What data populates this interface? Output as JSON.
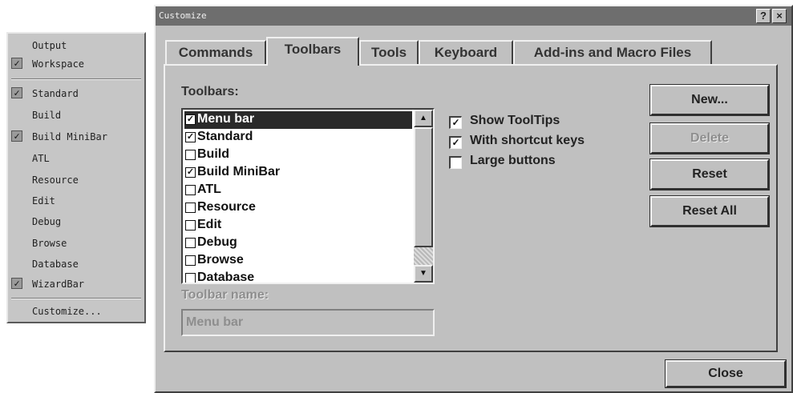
{
  "context_menu": {
    "items": [
      {
        "label": "Output",
        "checked": false
      },
      {
        "label": "Workspace",
        "checked": true
      },
      {
        "label": "Standard",
        "checked": true
      },
      {
        "label": "Build",
        "checked": false
      },
      {
        "label": "Build MiniBar",
        "checked": true
      },
      {
        "label": "ATL",
        "checked": false
      },
      {
        "label": "Resource",
        "checked": false
      },
      {
        "label": "Edit",
        "checked": false
      },
      {
        "label": "Debug",
        "checked": false
      },
      {
        "label": "Browse",
        "checked": false
      },
      {
        "label": "Database",
        "checked": false
      },
      {
        "label": "WizardBar",
        "checked": true
      },
      {
        "label": "Customize...",
        "checked": false
      }
    ]
  },
  "dialog": {
    "title": "Customize",
    "help_glyph": "?",
    "close_glyph": "×",
    "tabs": [
      {
        "label": "Commands",
        "active": false
      },
      {
        "label": "Toolbars",
        "active": true
      },
      {
        "label": "Tools",
        "active": false
      },
      {
        "label": "Keyboard",
        "active": false
      },
      {
        "label": "Add-ins and Macro Files",
        "active": false
      }
    ],
    "toolbars_label": "Toolbars:",
    "toolbar_list": [
      {
        "label": "Menu bar",
        "checked": true,
        "selected": true
      },
      {
        "label": "Standard",
        "checked": true,
        "selected": false
      },
      {
        "label": "Build",
        "checked": false,
        "selected": false
      },
      {
        "label": "Build MiniBar",
        "checked": true,
        "selected": false
      },
      {
        "label": "ATL",
        "checked": false,
        "selected": false
      },
      {
        "label": "Resource",
        "checked": false,
        "selected": false
      },
      {
        "label": "Edit",
        "checked": false,
        "selected": false
      },
      {
        "label": "Debug",
        "checked": false,
        "selected": false
      },
      {
        "label": "Browse",
        "checked": false,
        "selected": false
      },
      {
        "label": "Database",
        "checked": false,
        "selected": false
      }
    ],
    "options": [
      {
        "label": "Show ToolTips",
        "checked": true
      },
      {
        "label": "With shortcut keys",
        "checked": true
      },
      {
        "label": "Large buttons",
        "checked": false
      }
    ],
    "buttons": {
      "new": "New...",
      "delete": "Delete",
      "reset": "Reset",
      "reset_all": "Reset All",
      "close": "Close"
    },
    "toolbar_name_label": "Toolbar name:",
    "toolbar_name_value": "Menu bar",
    "scroll_up_glyph": "▲",
    "scroll_down_glyph": "▼",
    "check_glyph": "✓"
  }
}
